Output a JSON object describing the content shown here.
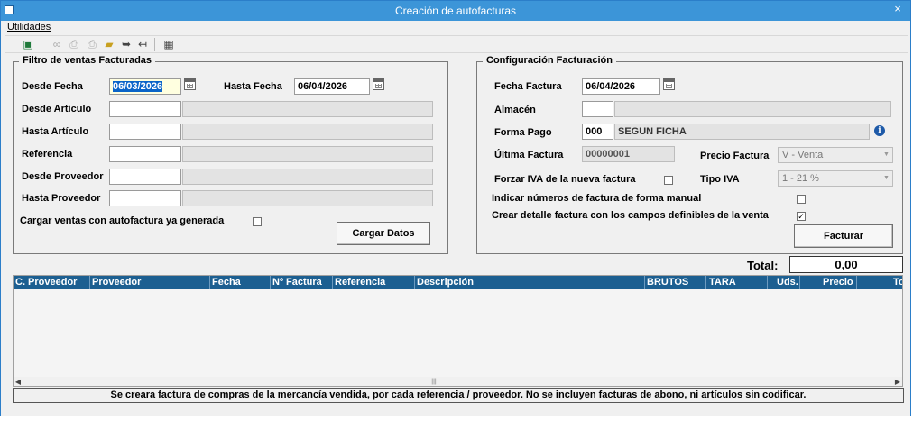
{
  "window": {
    "title": "Creación de autofacturas",
    "close_glyph": "×"
  },
  "menu": {
    "utilidades": "Utilidades"
  },
  "toolbar": {
    "icons": [
      "excel-export-icon",
      "binoculars-icon",
      "printer-preview-icon",
      "print-icon",
      "open-folder-icon",
      "forward-icon",
      "back-icon",
      "calculator-icon"
    ]
  },
  "filtro": {
    "title": "Filtro de ventas Facturadas",
    "desde_fecha_label": "Desde Fecha",
    "desde_fecha_value": "06/03/2026",
    "hasta_fecha_label": "Hasta Fecha",
    "hasta_fecha_value": "06/04/2026",
    "desde_articulo_label": "Desde Artículo",
    "hasta_articulo_label": "Hasta Artículo",
    "referencia_label": "Referencia",
    "desde_proveedor_label": "Desde Proveedor",
    "hasta_proveedor_label": "Hasta Proveedor",
    "cargar_ventas_label": "Cargar ventas con autofactura ya generada",
    "cargar_datos_button": "Cargar Datos"
  },
  "config": {
    "title": "Configuración Facturación",
    "fecha_factura_label": "Fecha Factura",
    "fecha_factura_value": "06/04/2026",
    "almacen_label": "Almacén",
    "forma_pago_label": "Forma Pago",
    "forma_pago_code": "000",
    "forma_pago_desc": "SEGUN FICHA",
    "ultima_factura_label": "Última Factura",
    "ultima_factura_value": "00000001",
    "precio_factura_label": "Precio Factura",
    "precio_factura_value": "V - Venta",
    "forzar_iva_label": "Forzar IVA de la nueva factura",
    "tipo_iva_label": "Tipo IVA",
    "tipo_iva_value": "1 - 21 %",
    "indicar_manual_label": "Indicar números de factura de forma manual",
    "crear_detalle_label": "Crear detalle factura con los campos definibles de la venta",
    "crear_detalle_checked": true,
    "facturar_button": "Facturar"
  },
  "total": {
    "label": "Total:",
    "value": "0,00"
  },
  "grid": {
    "columns": [
      "C. Proveedor",
      "Proveedor",
      "Fecha",
      "Nº Factura",
      "Referencia",
      "Descripción",
      "BRUTOS",
      "TARA",
      "Uds.",
      "Precio",
      "To"
    ]
  },
  "status": "Se creara factura de compras de la mercancía vendida, por cada referencia / proveedor. No se incluyen facturas de abono, ni artículos sin codificar."
}
